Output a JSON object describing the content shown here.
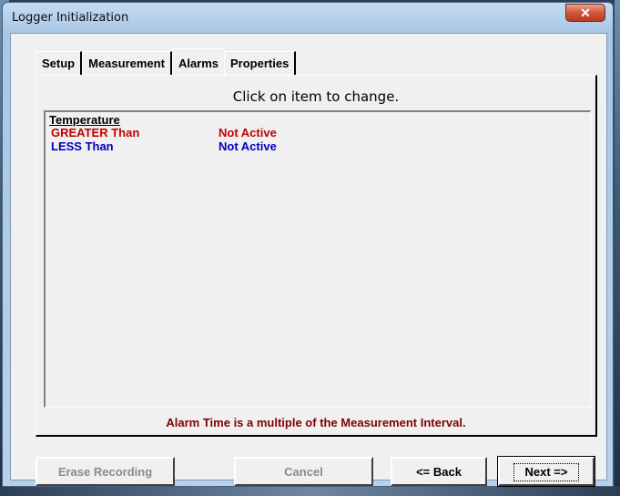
{
  "window": {
    "title": "Logger Initialization",
    "close_glyph": "✕"
  },
  "tabs": [
    {
      "label": "Setup"
    },
    {
      "label": "Measurement"
    },
    {
      "label": "Alarms"
    },
    {
      "label": "Properties"
    }
  ],
  "active_tab": "Alarms",
  "panel": {
    "hint": "Click on item to change.",
    "list_header": "Temperature",
    "alarms": [
      {
        "name": "GREATER Than",
        "status": "Not Active",
        "color": "#c00000"
      },
      {
        "name": "LESS Than",
        "status": "Not Active",
        "color": "#0000c0"
      }
    ],
    "note": "Alarm Time is a multiple of the Measurement Interval."
  },
  "buttons": {
    "erase": "Erase Recording",
    "cancel": "Cancel",
    "back": "<= Back",
    "next": "Next =>"
  }
}
